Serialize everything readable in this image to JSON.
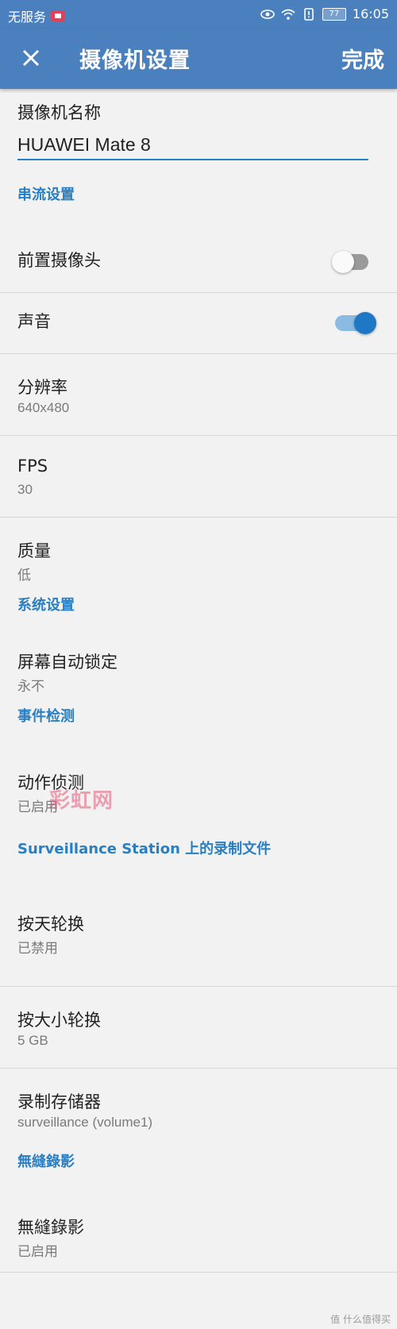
{
  "status_bar": {
    "carrier": "无服务",
    "battery": "77",
    "time": "16:05"
  },
  "app_bar": {
    "title": "摄像机设置",
    "done_label": "完成"
  },
  "camera_name": {
    "label": "摄像机名称",
    "value": "HUAWEI Mate 8"
  },
  "sections": {
    "stream": "串流设置",
    "system": "系统设置",
    "event": "事件检测",
    "recording": "Surveillance Station 上的录制文件",
    "seamless": "無縫錄影"
  },
  "rows": {
    "front_camera": {
      "title": "前置摄像头",
      "enabled": false
    },
    "sound": {
      "title": "声音",
      "enabled": true
    },
    "resolution": {
      "title": "分辨率",
      "value": "640x480"
    },
    "fps": {
      "title": "FPS",
      "value": "30"
    },
    "quality": {
      "title": "质量",
      "value": "低"
    },
    "screen_lock": {
      "title": "屏幕自动锁定",
      "value": "永不"
    },
    "motion": {
      "title": "动作侦测",
      "value": "已启用"
    },
    "rotate_day": {
      "title": "按天轮换",
      "value": "已禁用"
    },
    "rotate_size": {
      "title": "按大小轮换",
      "value": "5 GB"
    },
    "storage": {
      "title": "录制存储器",
      "value": "surveillance (volume1)"
    },
    "seamless": {
      "title": "無縫錄影",
      "value": "已启用"
    }
  },
  "watermark": "彩虹网",
  "footer_brand": "值 什么值得买",
  "colors": {
    "app_bar": "#4a80bd",
    "accent": "#2a7fc2",
    "background": "#f2f2f2"
  }
}
